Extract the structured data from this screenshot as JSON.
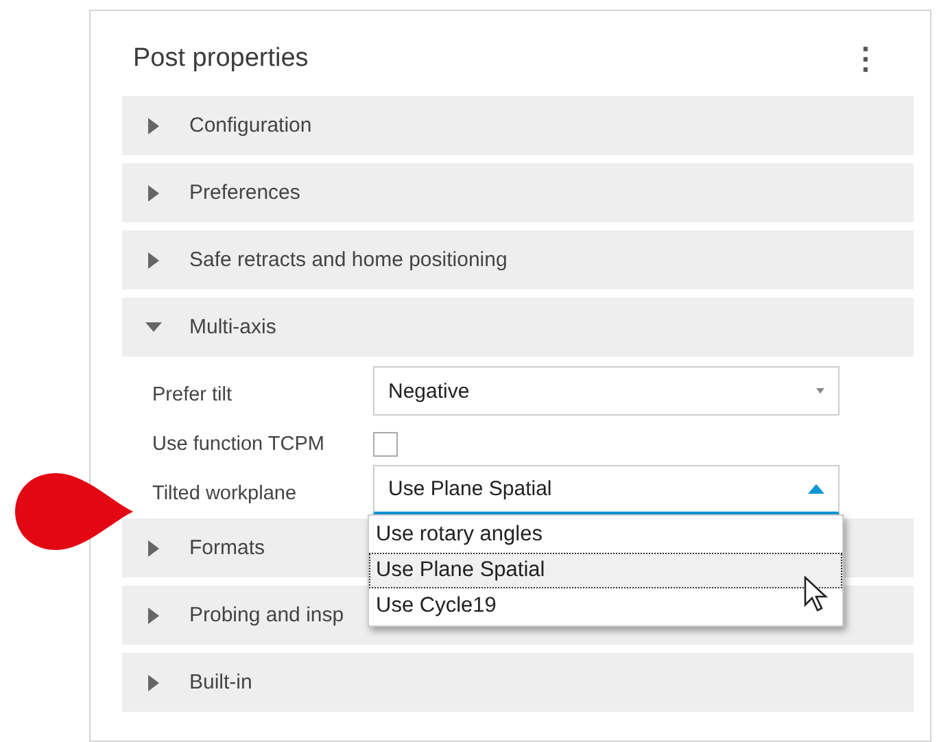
{
  "panel": {
    "title": "Post properties",
    "menu_icon": "⋮"
  },
  "sections": [
    {
      "label": "Configuration",
      "expanded": false
    },
    {
      "label": "Preferences",
      "expanded": false
    },
    {
      "label": "Safe retracts and home positioning",
      "expanded": false
    },
    {
      "label": "Multi-axis",
      "expanded": true,
      "fields": [
        {
          "kind": "select",
          "label": "Prefer tilt",
          "value": "Negative",
          "open": false
        },
        {
          "kind": "checkbox",
          "label": "Use function TCPM",
          "checked": false
        },
        {
          "kind": "select",
          "label": "Tilted workplane",
          "value": "Use Plane Spatial",
          "open": true,
          "options": [
            {
              "label": "Use rotary angles",
              "selected": false
            },
            {
              "label": "Use Plane Spatial",
              "selected": true
            },
            {
              "label": "Use Cycle19",
              "selected": false
            }
          ]
        }
      ]
    },
    {
      "label": "Formats",
      "expanded": false
    },
    {
      "label": "Probing and insp",
      "expanded": false
    },
    {
      "label": "Built-in",
      "expanded": false
    }
  ],
  "annotation": {
    "kind": "marker",
    "color": "#e30613"
  }
}
